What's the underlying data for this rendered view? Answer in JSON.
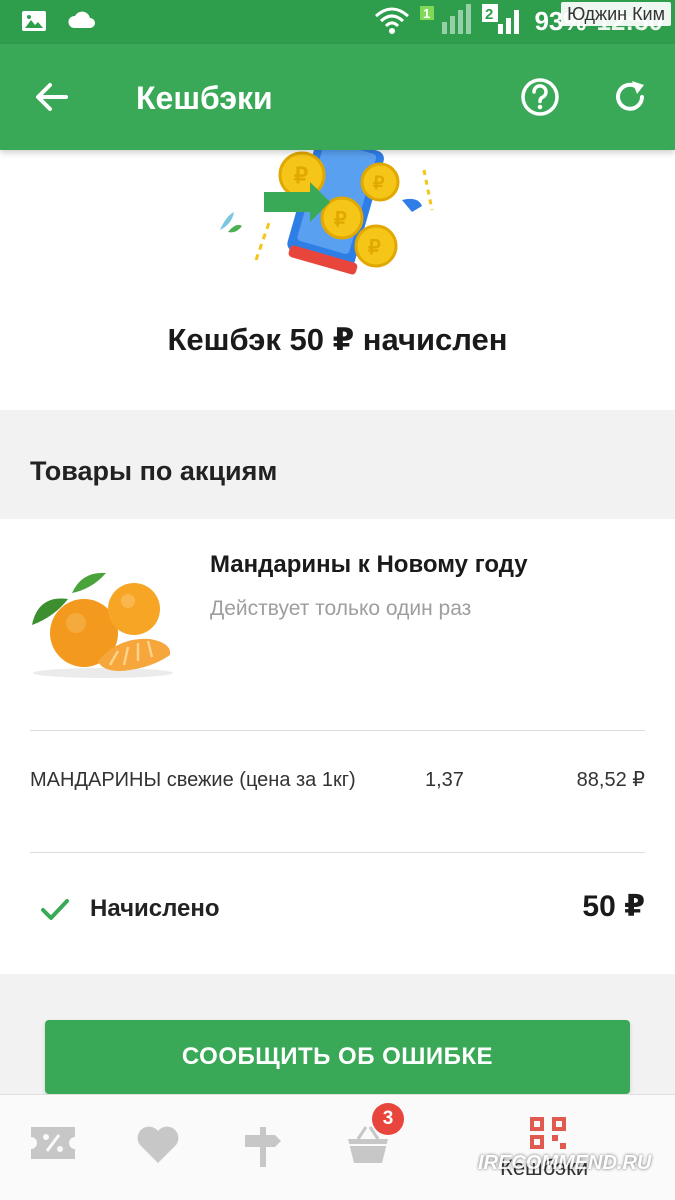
{
  "status_bar": {
    "battery": "93%",
    "time": "12:50",
    "user_overlay": "Юджин Ким",
    "sim_number": "2",
    "signal_number": "1"
  },
  "app_bar": {
    "title": "Кешбэки"
  },
  "hero": {
    "title": "Кешбэк 50 ₽ начислен"
  },
  "section": {
    "title": "Товары по акциям"
  },
  "promo": {
    "name": "Мандарины к Новому году",
    "note": "Действует только один раз",
    "item": {
      "name": "МАНДАРИНЫ свежие (цена за 1кг)",
      "qty": "1,37",
      "sum": "88,52 ₽"
    },
    "accrued_label": "Начислено",
    "accrued_value": "50 ₽"
  },
  "report_button": {
    "label": "СООБЩИТЬ ОБ ОШИБКЕ"
  },
  "bottom_nav": {
    "items": [
      {
        "icon": "discount-tag-icon"
      },
      {
        "icon": "heart-icon"
      },
      {
        "icon": "signpost-icon"
      },
      {
        "icon": "basket-icon",
        "badge": "3"
      },
      {
        "icon": "qr-code-icon",
        "label": "Кешбэки",
        "active": true
      }
    ]
  },
  "watermark": "IRECOMMEND.RU",
  "colors": {
    "primary_green": "#3aa957",
    "status_green": "#2e9e4c",
    "badge_red": "#e8453c",
    "active_nav_red": "#e05a4f"
  }
}
